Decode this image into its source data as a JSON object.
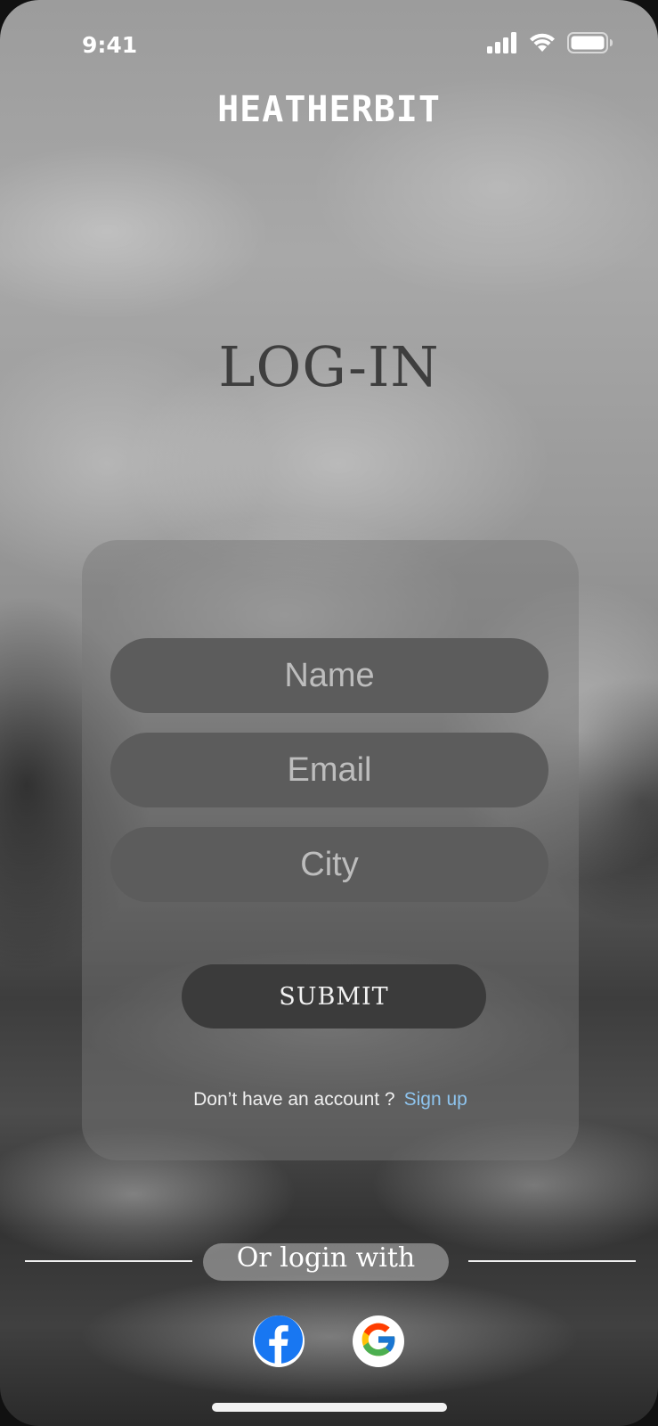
{
  "status_bar": {
    "time": "9:41"
  },
  "brand": {
    "name": "HEATHERBIT"
  },
  "page": {
    "title": "LOG-IN"
  },
  "form": {
    "name_placeholder": "Name",
    "email_placeholder": "Email",
    "city_placeholder": "City",
    "submit_label": "SUBMIT",
    "no_account_text": "Don’t have an account ?",
    "signup_label": "Sign up"
  },
  "social": {
    "divider_label": "Or login with",
    "providers": [
      "facebook-icon",
      "google-icon"
    ]
  },
  "colors": {
    "link": "#8ec4ee",
    "field_bg": "#5c5c5c",
    "button_bg": "#3b3b3b",
    "title": "#3e3e3e",
    "facebook": "#1877f2"
  }
}
